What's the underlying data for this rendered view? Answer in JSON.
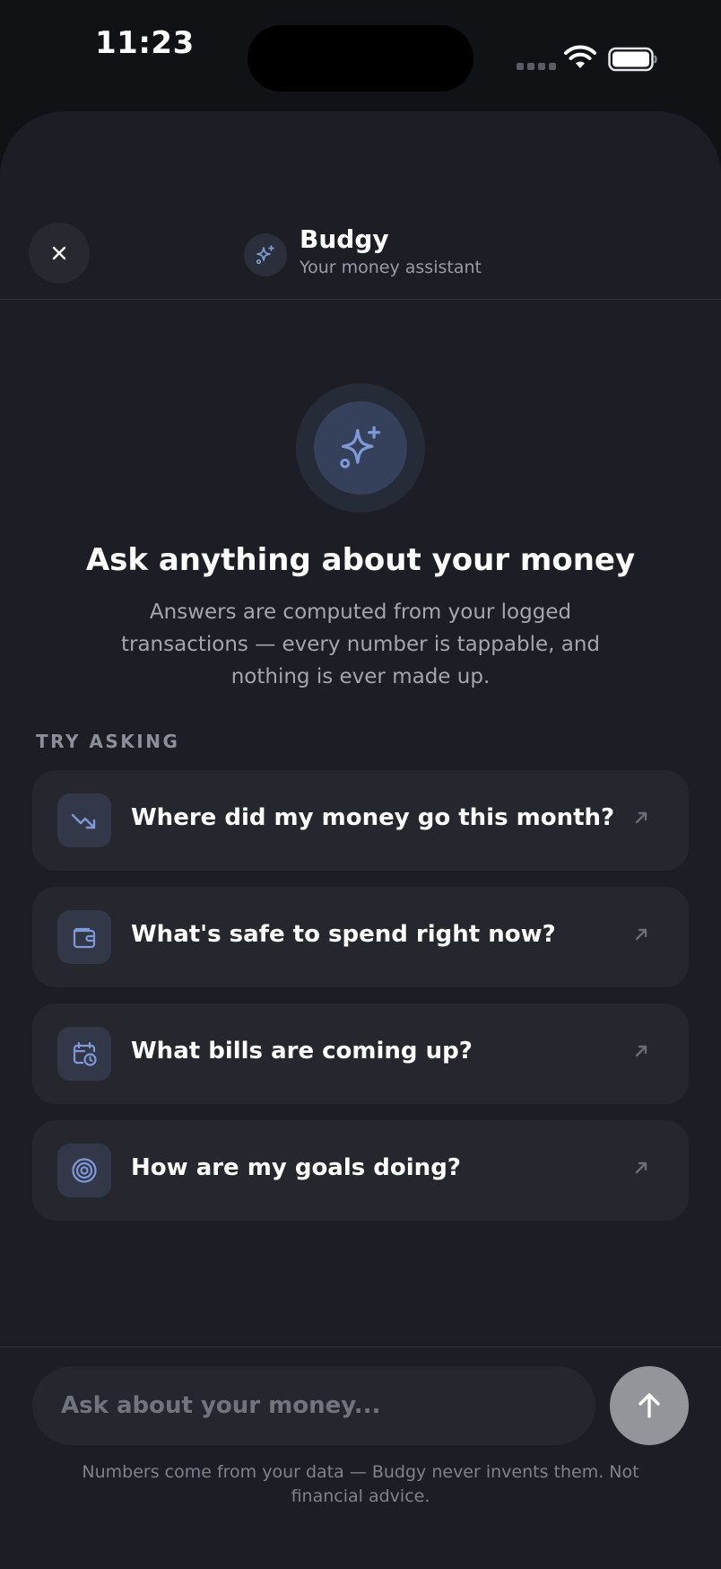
{
  "status_bar": {
    "time": "11:23"
  },
  "header": {
    "title": "Budgy",
    "subtitle": "Your money assistant",
    "close_icon": "close-icon",
    "avatar_icon": "sparkles-icon"
  },
  "hero": {
    "icon": "sparkles-icon",
    "headline": "Ask anything about your money",
    "description": "Answers are computed from your logged transactions — every number is tappable, and nothing is ever made up."
  },
  "suggestions": {
    "label": "TRY ASKING",
    "items": [
      {
        "icon": "trending-down-icon",
        "label": "Where did my money go this month?"
      },
      {
        "icon": "wallet-icon",
        "label": "What's safe to spend right now?"
      },
      {
        "icon": "calendar-clock-icon",
        "label": "What bills are coming up?"
      },
      {
        "icon": "target-icon",
        "label": "How are my goals doing?"
      }
    ]
  },
  "composer": {
    "placeholder": "Ask about your money...",
    "value": "",
    "send_icon": "arrow-up-icon"
  },
  "disclaimer": "Numbers come from your data — Budgy never invents them. Not financial advice.",
  "colors": {
    "background": "#1d1e25",
    "card": "#25262e",
    "accent": "#7f98d8",
    "text_primary": "#ffffff",
    "text_secondary": "#a4a6ae"
  }
}
